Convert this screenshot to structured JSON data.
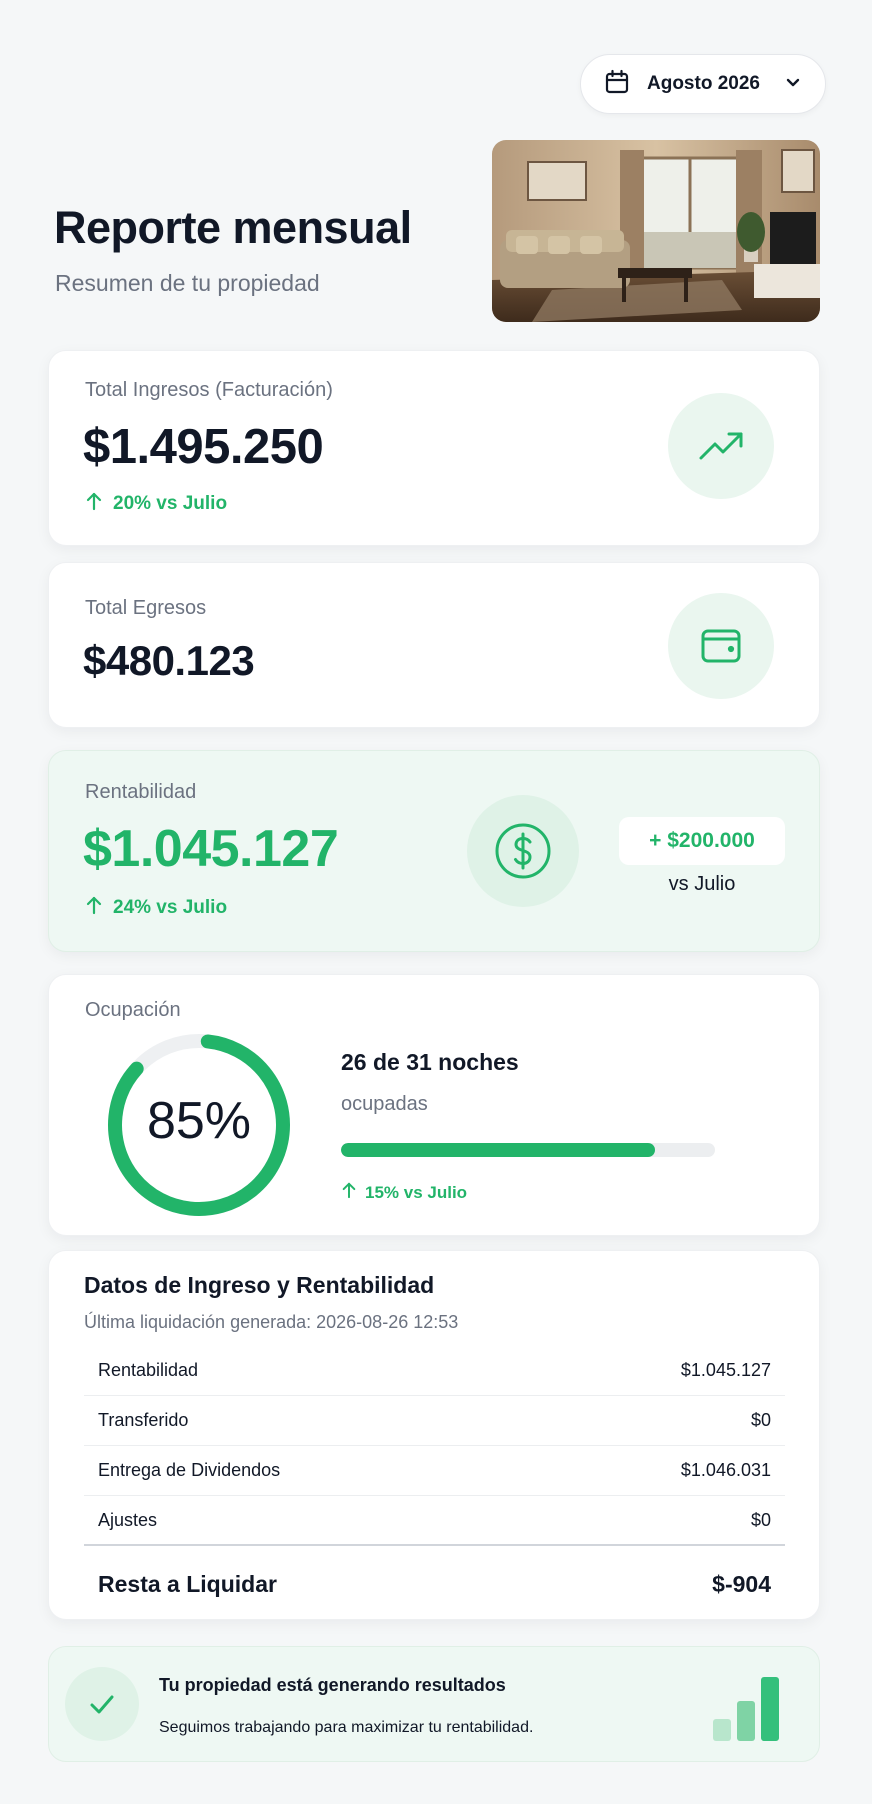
{
  "header": {
    "month_label": "Agosto 2026",
    "title": "Reporte mensual",
    "subtitle": "Resumen de tu propiedad"
  },
  "income": {
    "label": "Total Ingresos (Facturación)",
    "value": "$1.495.250",
    "delta": "20% vs Julio",
    "icon": "trending-up-icon"
  },
  "expenses": {
    "label": "Total Egresos",
    "value": "$480.123",
    "icon": "wallet-icon"
  },
  "profitability": {
    "label": "Rentabilidad",
    "value": "$1.045.127",
    "delta": "24% vs Julio",
    "badge": "+ $200.000",
    "badge_caption": "vs Julio",
    "icon": "dollar-icon"
  },
  "occupancy": {
    "label": "Ocupación",
    "percent_label": "85%",
    "percent": 0.85,
    "nights": "26 de 31 noches",
    "nights_caption": "ocupadas",
    "progress": 0.8387,
    "delta": "15% vs Julio"
  },
  "settlement": {
    "title": "Datos de Ingreso y Rentabilidad",
    "subtitle": "Última liquidación generada: 2026-08-26 12:53",
    "rows": [
      {
        "label": "Rentabilidad",
        "value": "$1.045.127"
      },
      {
        "label": "Transferido",
        "value": "$0"
      },
      {
        "label": "Entrega de Dividendos",
        "value": "$1.046.031"
      },
      {
        "label": "Ajustes",
        "value": "$0"
      }
    ],
    "total_label": "Resta a Liquidar",
    "total_value": "$-904"
  },
  "banner": {
    "title": "Tu propiedad está generando resultados",
    "text": "Seguimos trabajando para maximizar tu rentabilidad.",
    "icon": "check-icon"
  },
  "colors": {
    "accent": "#22b469",
    "background": "#f5f7f8",
    "text": "#111827",
    "muted": "#6b7280"
  }
}
